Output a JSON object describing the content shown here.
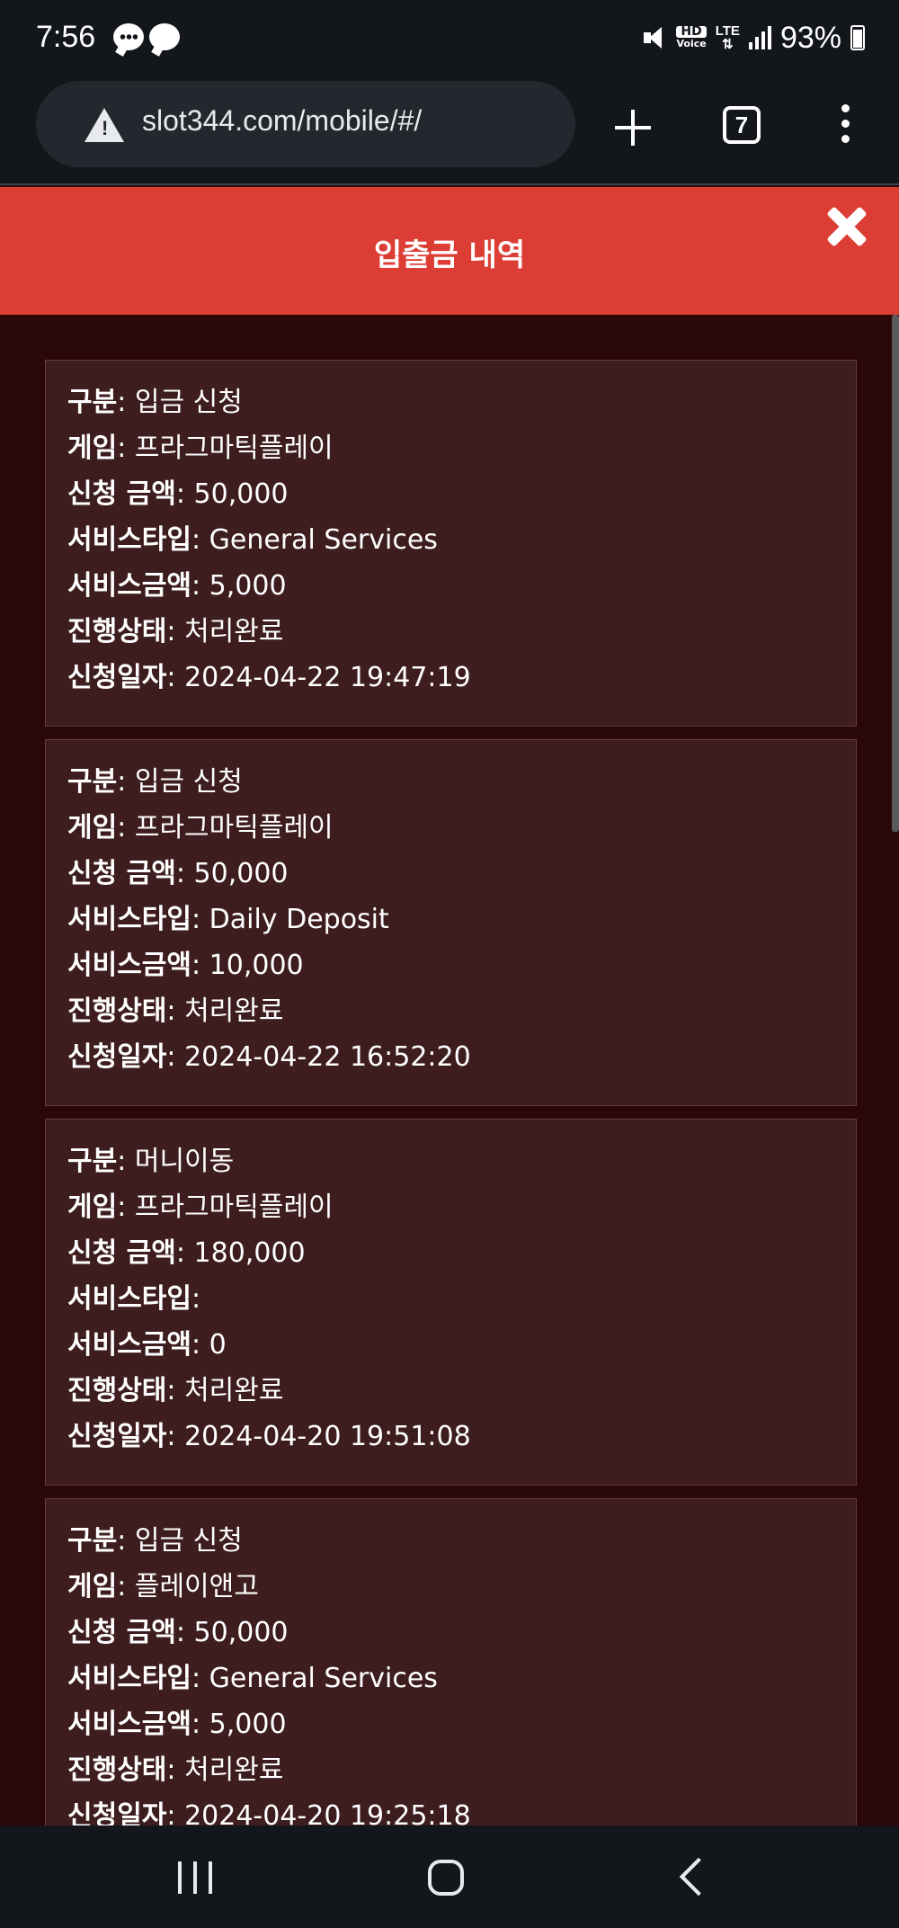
{
  "status_bar": {
    "time": "7:56",
    "hd_label": "HD",
    "voice_label": "Voice",
    "lte_label": "LTE",
    "battery": "93%",
    "notification_icons": [
      "chat-bubble-icon",
      "chat-bubble-icon"
    ]
  },
  "browser": {
    "url": "slot344.com/mobile/#/",
    "tab_count": "7"
  },
  "modal": {
    "title": "입출금 내역"
  },
  "labels": {
    "type": "구분",
    "game": "게임",
    "amount": "신청 금액",
    "service_type": "서비스타입",
    "service_amount": "서비스금액",
    "status": "진행상태",
    "date": "신청일자"
  },
  "records": [
    {
      "type": "입금 신청",
      "game": "프라그마틱플레이",
      "amount": "50,000",
      "service_type": "General Services",
      "service_amount": "5,000",
      "status": "처리완료",
      "date": "2024-04-22 19:47:19"
    },
    {
      "type": "입금 신청",
      "game": "프라그마틱플레이",
      "amount": "50,000",
      "service_type": "Daily Deposit",
      "service_amount": "10,000",
      "status": "처리완료",
      "date": "2024-04-22 16:52:20"
    },
    {
      "type": "머니이동",
      "game": "프라그마틱플레이",
      "amount": "180,000",
      "service_type": "",
      "service_amount": "0",
      "status": "처리완료",
      "date": "2024-04-20 19:51:08"
    },
    {
      "type": "입금 신청",
      "game": "플레이앤고",
      "amount": "50,000",
      "service_type": "General Services",
      "service_amount": "5,000",
      "status": "처리완료",
      "date": "2024-04-20 19:25:18"
    }
  ],
  "colors": {
    "header": "#dc3e35",
    "background": "#2a0808",
    "card": "#3e1d1e",
    "card_border": "#6a3a3a",
    "system_bar": "#13161b"
  }
}
